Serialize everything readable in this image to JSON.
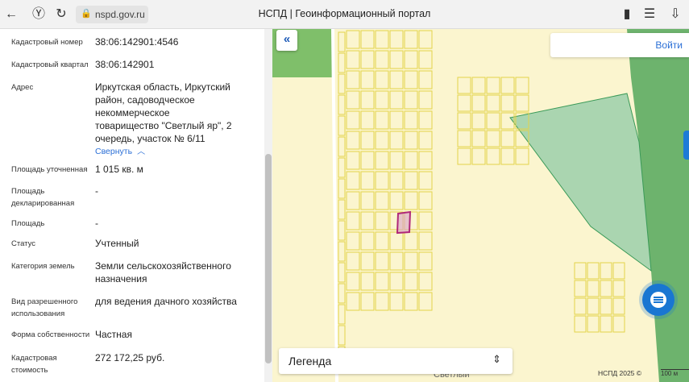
{
  "browser": {
    "url": "nspd.gov.ru",
    "title": "НСПД | Геоинформационный портал"
  },
  "panel": {
    "fields": [
      {
        "label": "Кадастровый номер",
        "value": "38:06:142901:4546"
      },
      {
        "label": "Кадастровый квартал",
        "value": "38:06:142901"
      },
      {
        "label": "Адрес",
        "value": "Иркутская область, Иркутский район, садоводческое некоммерческое товарищество \"Светлый яр\", 2 очередь, участок № 6/11"
      },
      {
        "label": "Площадь уточненная",
        "value": "1 015 кв. м"
      },
      {
        "label": "Площадь декларированная",
        "value": "-"
      },
      {
        "label": "Площадь",
        "value": "-"
      },
      {
        "label": "Статус",
        "value": "Учтенный"
      },
      {
        "label": "Категория земель",
        "value": "Земли сельскохозяйственного назначения"
      },
      {
        "label": "Вид разрешенного использования",
        "value": "для ведения дачного хозяйства"
      },
      {
        "label": "Форма собственности",
        "value": "Частная"
      },
      {
        "label": "Кадастровая стоимость",
        "value": "272 172,25 руб."
      }
    ],
    "collapse_label": "Свернуть"
  },
  "map": {
    "login_label": "Войти",
    "legend_label": "Легенда",
    "copyright": "НСПД 2025 ©",
    "scale_label": "100 м",
    "place_label": "Светлый",
    "colors": {
      "background": "#fbf5cf",
      "parcel_stroke": "#e8d850",
      "forest": "#6db36d",
      "selected": "#b0287a"
    }
  }
}
